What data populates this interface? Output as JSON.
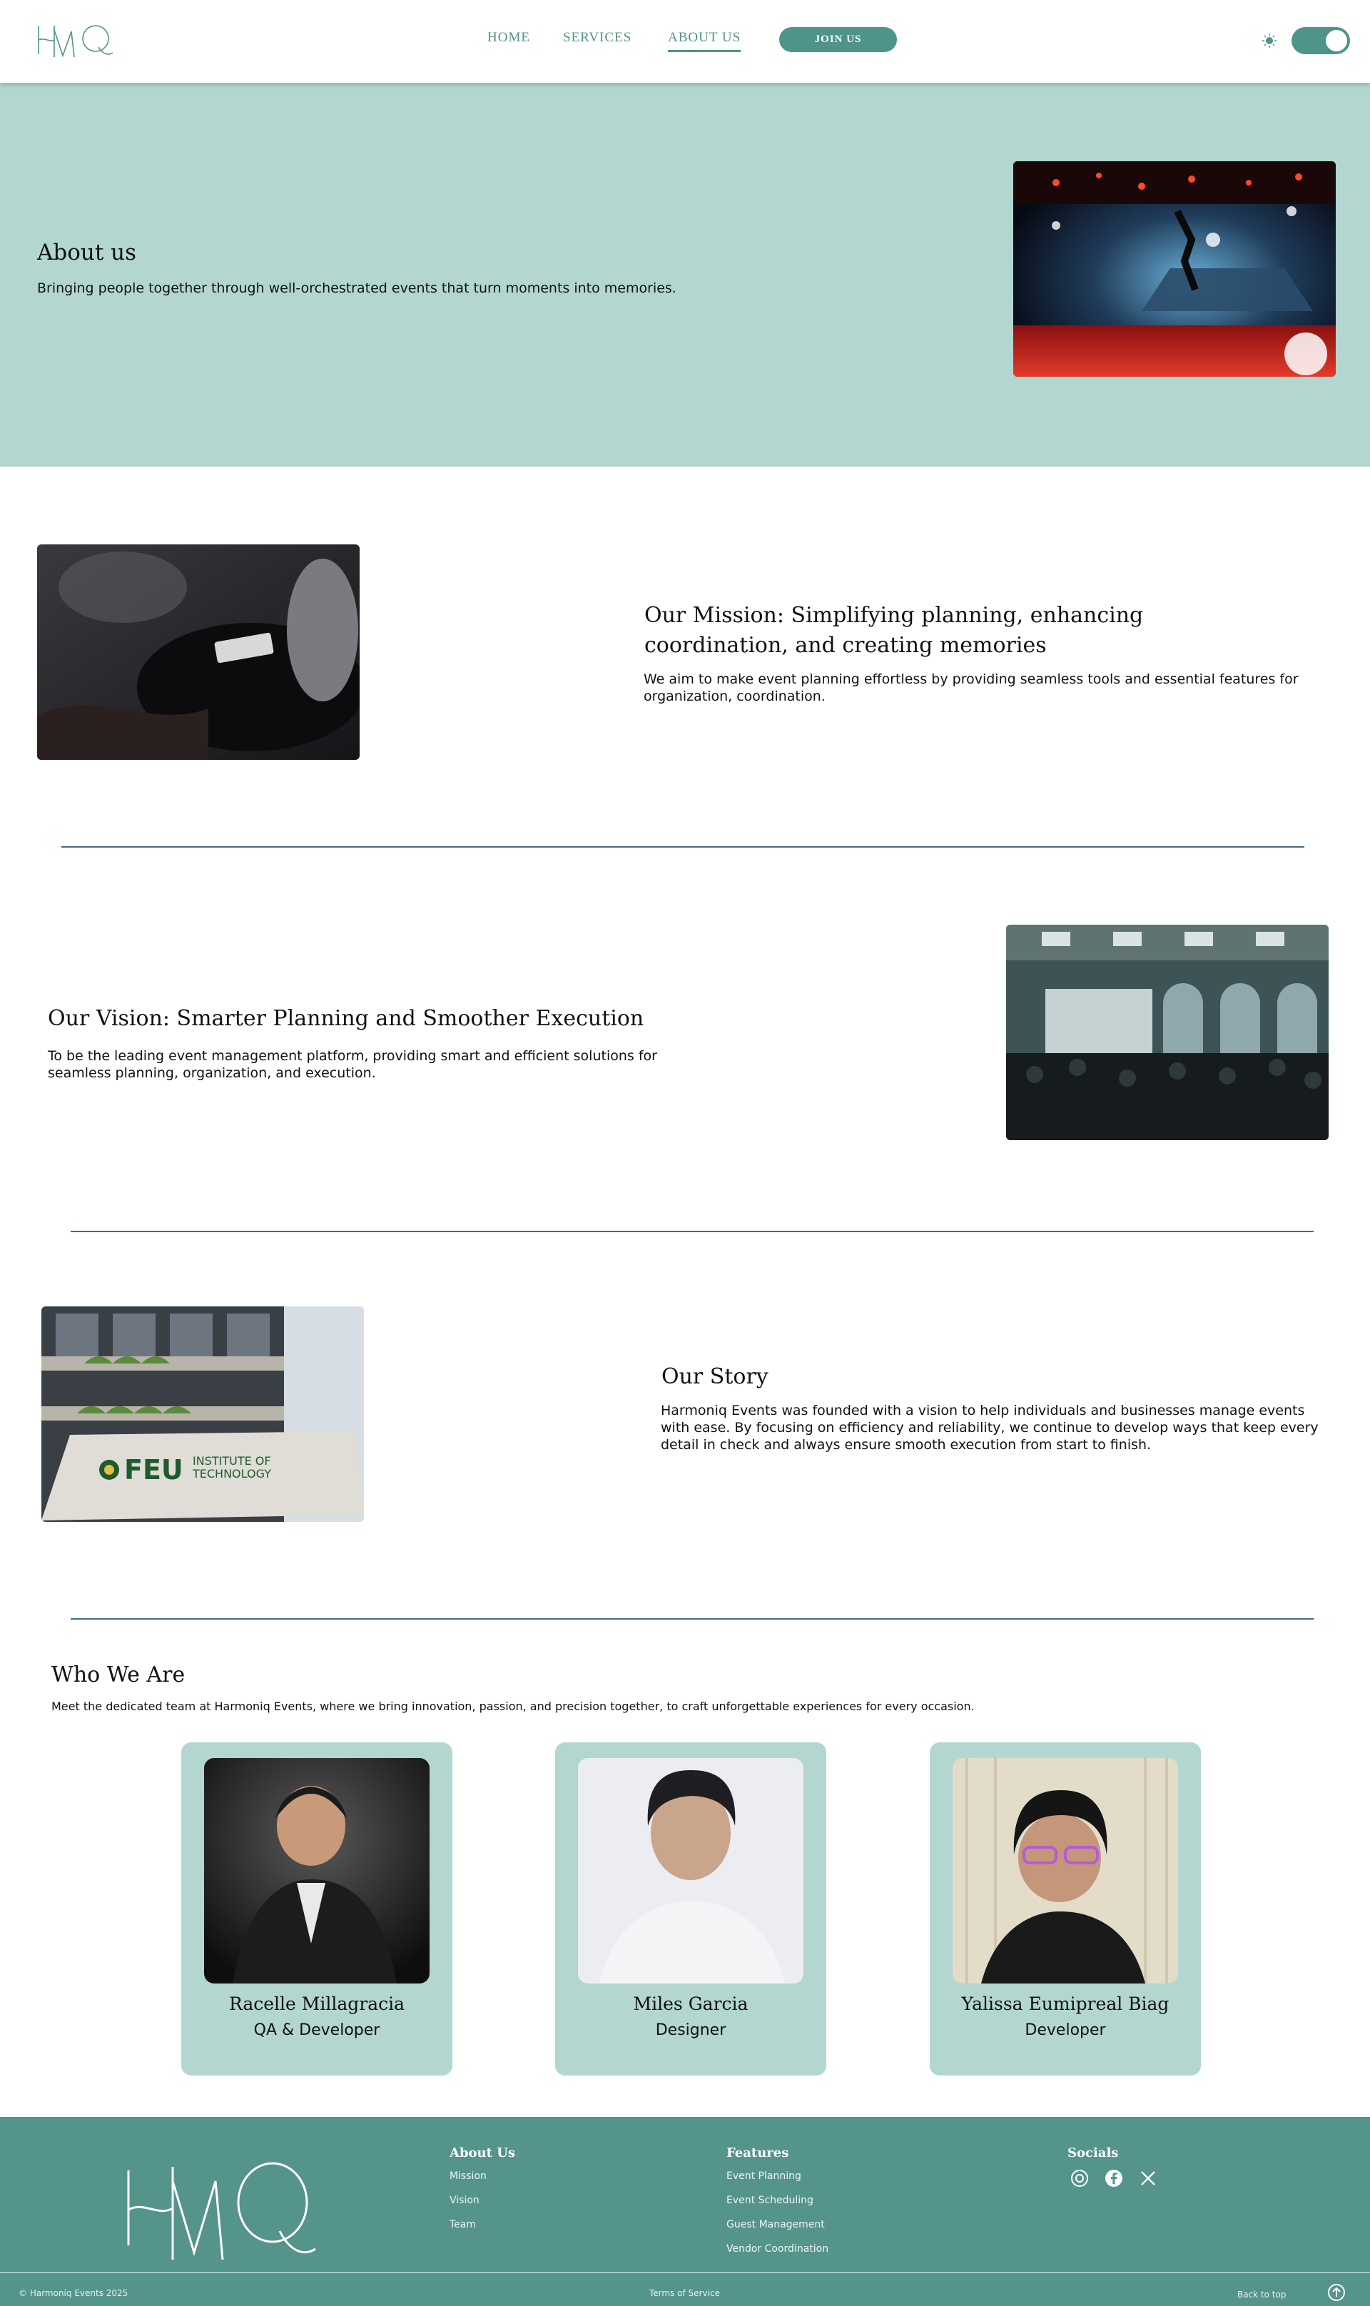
{
  "header": {
    "logo_text": "HMQ",
    "nav": [
      {
        "label": "HOME"
      },
      {
        "label": "SERVICES"
      },
      {
        "label": "ABOUT US"
      }
    ],
    "join_label": "JOIN US",
    "theme_toggle": {
      "state": "on",
      "icon": "sun-icon"
    }
  },
  "hero": {
    "title": "About us",
    "subtitle": "Bringing people together through well-orchestrated events that turn moments into memories.",
    "image": "concert-stage-photo"
  },
  "mission": {
    "title_line1": "Our Mission: Simplifying planning, enhancing",
    "title_line2": "coordination, and creating memories",
    "body": "We aim to make event planning effortless by providing seamless tools and essential features for organization, coordination.",
    "image": "audience-taking-notes-photo"
  },
  "vision": {
    "title": "Our Vision: Smarter Planning and Smoother Execution",
    "body": "To be the leading event management platform, providing smart and efficient solutions for seamless planning, organization, and execution.",
    "image": "conference-hall-photo"
  },
  "story": {
    "title": "Our Story",
    "body": "Harmoniq Events was founded with a vision to help individuals and businesses manage events with ease. By focusing on efficiency and reliability, we continue to develop ways that keep every detail in check and always ensure smooth execution from start to finish.",
    "image": "feu-building-photo",
    "sign_line1": "FEU",
    "sign_line2": "INSTITUTE OF",
    "sign_line3": "TECHNOLOGY"
  },
  "team": {
    "title": "Who We Are",
    "intro": "Meet the dedicated team at Harmoniq Events, where we bring innovation, passion, and precision together, to craft unforgettable experiences for every occasion.",
    "members": [
      {
        "name": "Racelle Millagracia",
        "role": "QA & Developer"
      },
      {
        "name": "Miles Garcia",
        "role": "Designer"
      },
      {
        "name": "Yalissa Eumipreal Biag",
        "role": "Developer"
      }
    ]
  },
  "footer": {
    "logo_text": "HMQ",
    "about": {
      "heading": "About Us",
      "links": [
        "Mission",
        "Vision",
        "Team"
      ]
    },
    "features": {
      "heading": "Features",
      "links": [
        "Event Planning",
        "Event Scheduling",
        "Guest Management",
        "Vendor Coordination"
      ]
    },
    "socials": {
      "heading": "Socials",
      "icons": [
        "instagram-icon",
        "facebook-icon",
        "x-icon"
      ]
    },
    "copyright": "© Harmoniq Events 2025",
    "terms": "Terms of Service",
    "back_to_top": "Back to top"
  },
  "colors": {
    "teal": "#4f9488",
    "mint": "#b3d6d0",
    "footer": "#55948a",
    "divider": "#3d6b85"
  }
}
